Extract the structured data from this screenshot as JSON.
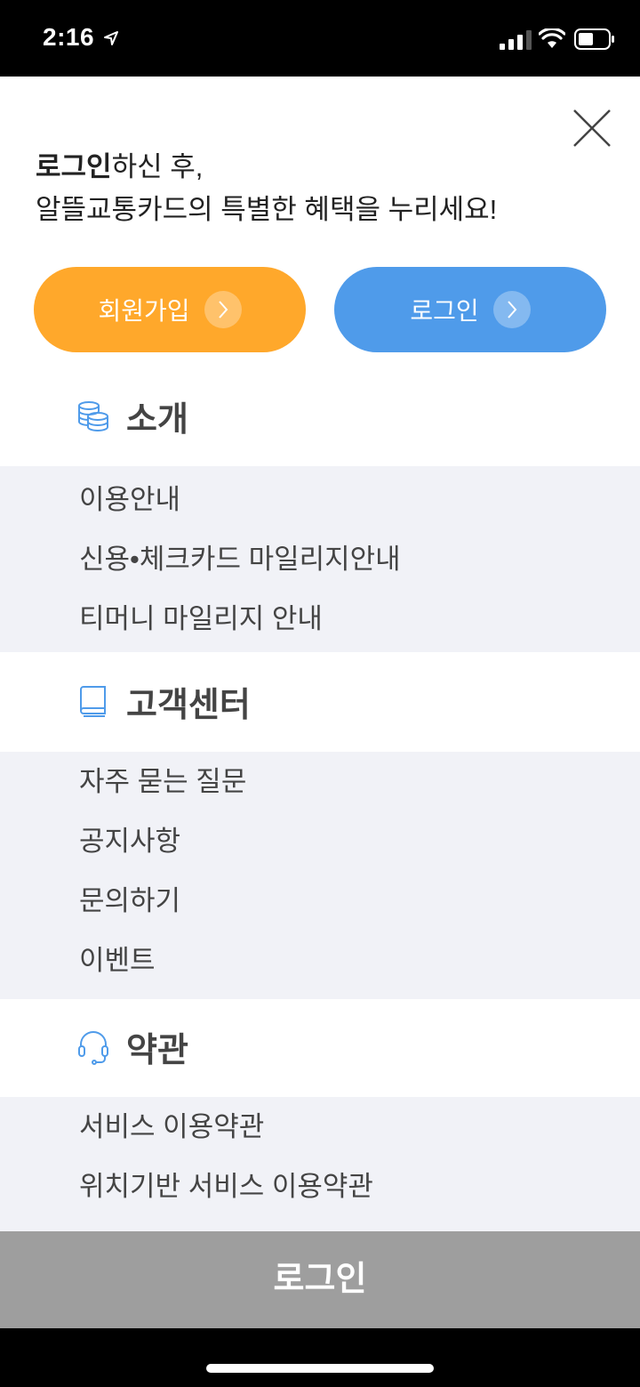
{
  "status_bar": {
    "time": "2:16"
  },
  "promo": {
    "bold": "로그인",
    "line1_rest": "하신 후,",
    "line2": "알뜰교통카드의 특별한 혜택을 누리세요!"
  },
  "buttons": {
    "signup": "회원가입",
    "login": "로그인"
  },
  "colors": {
    "signup": "#FFA82B",
    "login": "#4F9BEA",
    "icon_blue": "#4F9BEA",
    "list_bg": "#F1F2F7",
    "footer": "#9E9E9E"
  },
  "sections": [
    {
      "title": "소개",
      "icon": "coins-icon",
      "items": [
        "이용안내",
        "신용•체크카드 마일리지안내",
        "티머니 마일리지 안내"
      ]
    },
    {
      "title": "고객센터",
      "icon": "book-icon",
      "items": [
        "자주 묻는 질문",
        "공지사항",
        "문의하기",
        "이벤트"
      ]
    },
    {
      "title": "약관",
      "icon": "headset-icon",
      "items": [
        "서비스 이용약관",
        "위치기반 서비스 이용약관"
      ]
    }
  ],
  "footer": {
    "login": "로그인"
  }
}
